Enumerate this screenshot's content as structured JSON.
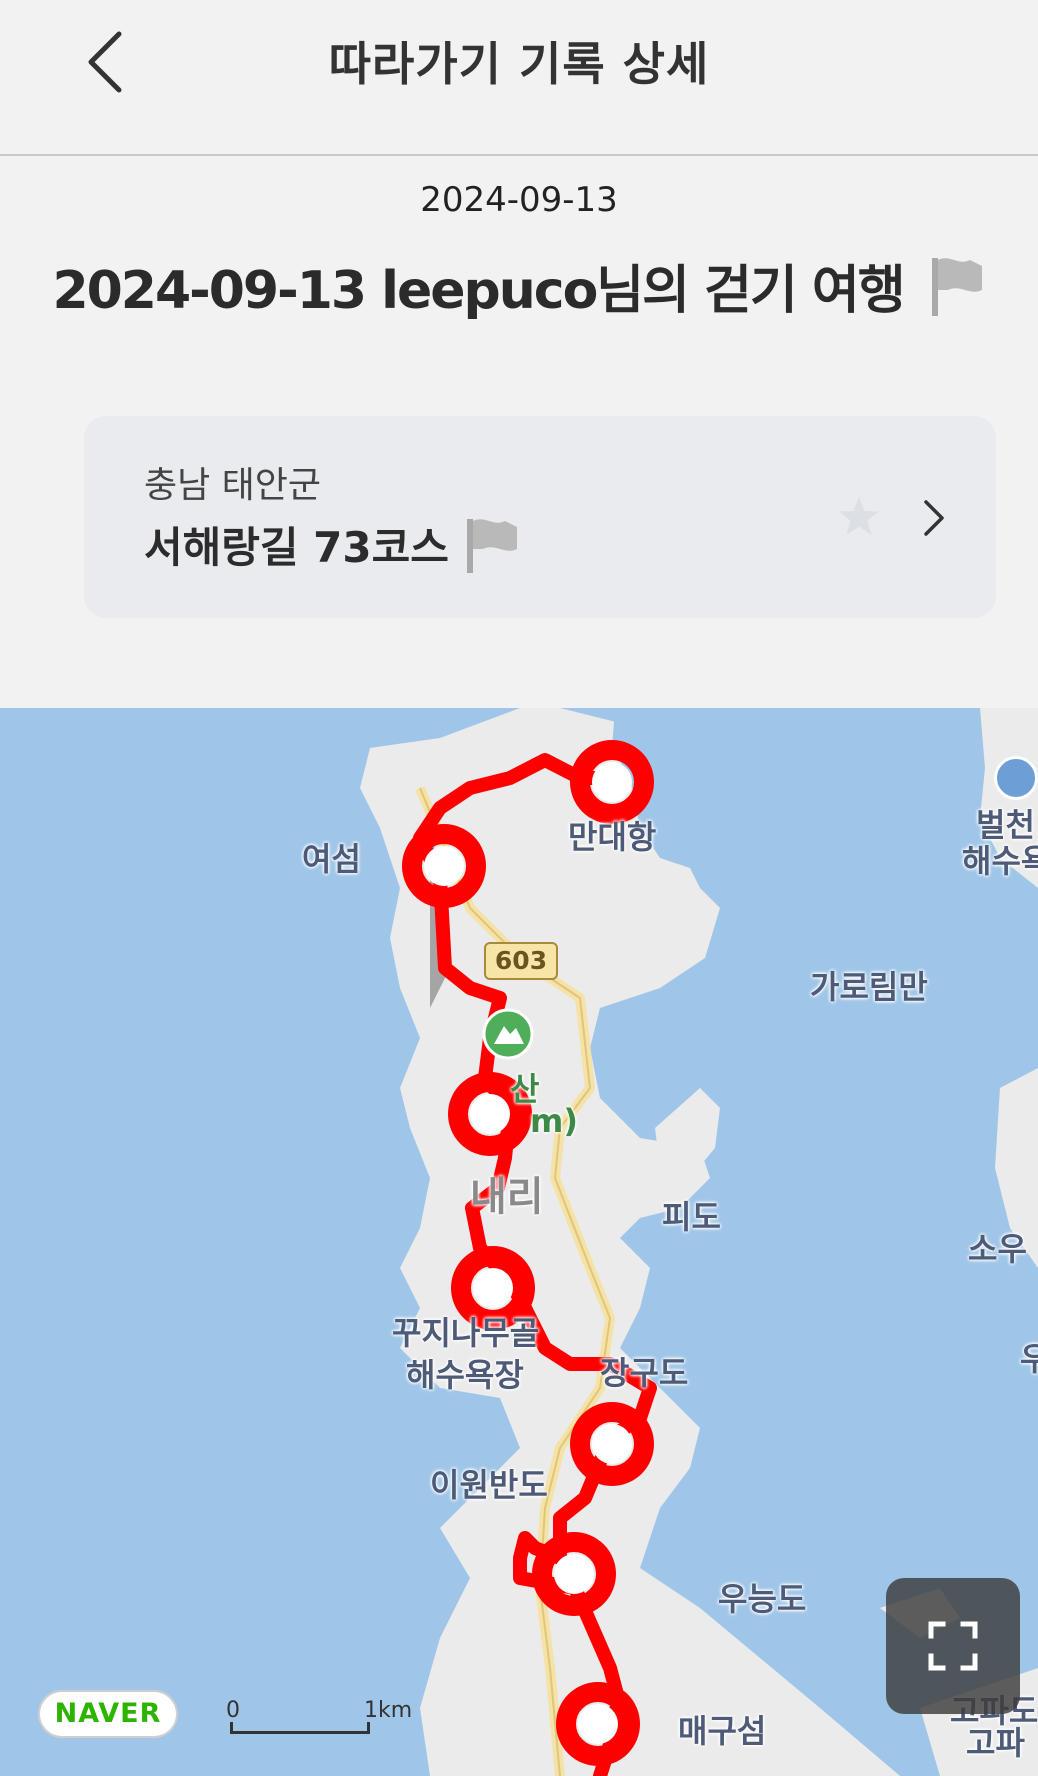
{
  "header": {
    "title": "따라가기 기록 상세",
    "back_icon": "chevron-left-icon"
  },
  "record": {
    "date": "2024-09-13",
    "title": "2024-09-13 leepuco님의 걷기 여행",
    "flag_icon": "flag-icon"
  },
  "course_card": {
    "region": "충남 태안군",
    "name": "서해랑길 73코스",
    "star_icon": "star-icon",
    "chevron_icon": "chevron-right-icon"
  },
  "map": {
    "labels": {
      "yeoseom": "여섬",
      "mallipo": "만대항",
      "beolcheon_top": "벌천",
      "beolcheon_bottom": "해수욕",
      "garorim": "가로림만",
      "mountain_top": "산",
      "mountain_bottom": "m)",
      "naeri": "내리",
      "pido": "피도",
      "sou": "소우",
      "kkujiinamu_top": "꾸지나무골",
      "kkujiinamu_bottom": "해수욕장",
      "janggudo": "장구도",
      "iwonbando": "이원반도",
      "uneungdo": "우능도",
      "maeguseom": "매구섬",
      "gopado_top": "고파도",
      "gopado_bottom": "고파",
      "u_right": "우"
    },
    "road_number": "603",
    "provider": "NAVER",
    "scale": {
      "zero": "0",
      "unit": "1km"
    },
    "fullscreen_icon": "fullscreen-icon",
    "colors": {
      "route": "#ff0000",
      "water": "#9fc6e8",
      "land": "#ebebeb",
      "road": "#f5e2a6"
    }
  }
}
